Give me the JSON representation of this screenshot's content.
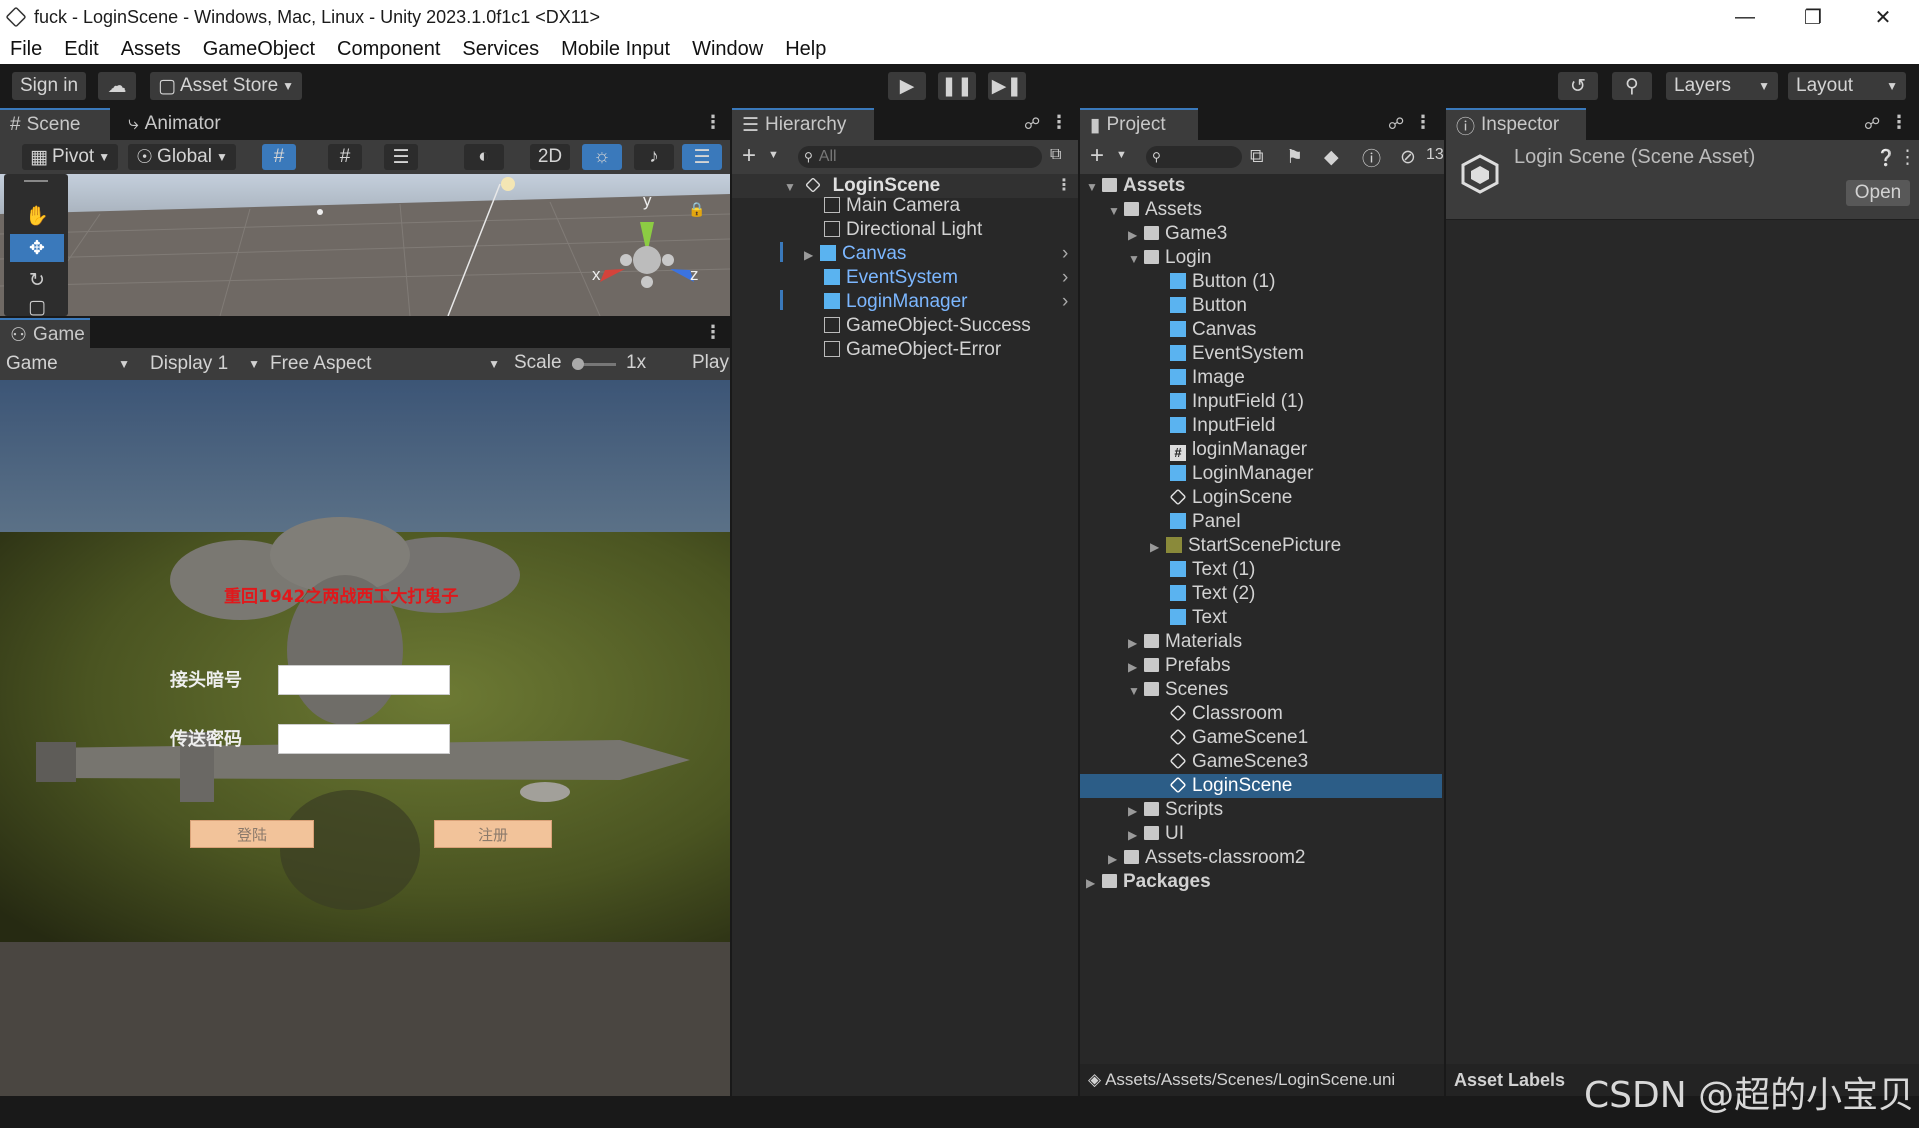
{
  "window": {
    "title": "fuck - LoginScene - Windows, Mac, Linux - Unity 2023.1.0f1c1 <DX11>"
  },
  "menu": [
    "File",
    "Edit",
    "Assets",
    "GameObject",
    "Component",
    "Services",
    "Mobile Input",
    "Window",
    "Help"
  ],
  "toolbar": {
    "sign_in": "Sign in",
    "asset_store": "Asset Store",
    "layers": "Layers",
    "layout": "Layout"
  },
  "scene": {
    "tab_scene": "Scene",
    "tab_animator": "Animator",
    "pivot": "Pivot",
    "global": "Global",
    "mode_2d": "2D",
    "gizmo_y": "y",
    "gizmo_x": "x",
    "gizmo_z": "z"
  },
  "game": {
    "tab": "Game",
    "view": "Game",
    "display": "Display 1",
    "aspect": "Free Aspect",
    "scale_label": "Scale",
    "scale_value": "1x",
    "play": "Play",
    "title_text": "重回1942之两战西工大打鬼子",
    "label_user": "接头暗号",
    "label_pass": "传送密码",
    "login_btn": "登陆",
    "register_btn": "注册"
  },
  "hierarchy": {
    "tab": "Hierarchy",
    "search_placeholder": "All",
    "scene": "LoginScene",
    "items": [
      "Main Camera",
      "Directional Light",
      "Canvas",
      "EventSystem",
      "LoginManager",
      "GameObject-Success",
      "GameObject-Error"
    ]
  },
  "project": {
    "tab": "Project",
    "hidden_count": "13",
    "root": "Assets",
    "assets": "Assets",
    "game3": "Game3",
    "login": "Login",
    "login_items": [
      "Button (1)",
      "Button",
      "Canvas",
      "EventSystem",
      "Image",
      "InputField (1)",
      "InputField",
      "loginManager",
      "LoginManager",
      "LoginScene",
      "Panel",
      "StartScenePicture",
      "Text (1)",
      "Text (2)",
      "Text"
    ],
    "materials": "Materials",
    "prefabs": "Prefabs",
    "scenes": "Scenes",
    "scene_items": [
      "Classroom",
      "GameScene1",
      "GameScene3",
      "LoginScene"
    ],
    "scripts": "Scripts",
    "ui": "UI",
    "assets_classroom2": "Assets-classroom2",
    "packages": "Packages",
    "path": "Assets/Assets/Scenes/LoginScene.uni"
  },
  "inspector": {
    "tab": "Inspector",
    "title": "Login Scene (Scene Asset)",
    "open": "Open",
    "asset_labels": "Asset Labels"
  },
  "watermark": "CSDN @超的小宝贝",
  "colors": {
    "accent": "#3a79bb",
    "selection": "#2c5d87",
    "prefab_blue": "#7cb7ff",
    "title_red": "#e0181b"
  }
}
